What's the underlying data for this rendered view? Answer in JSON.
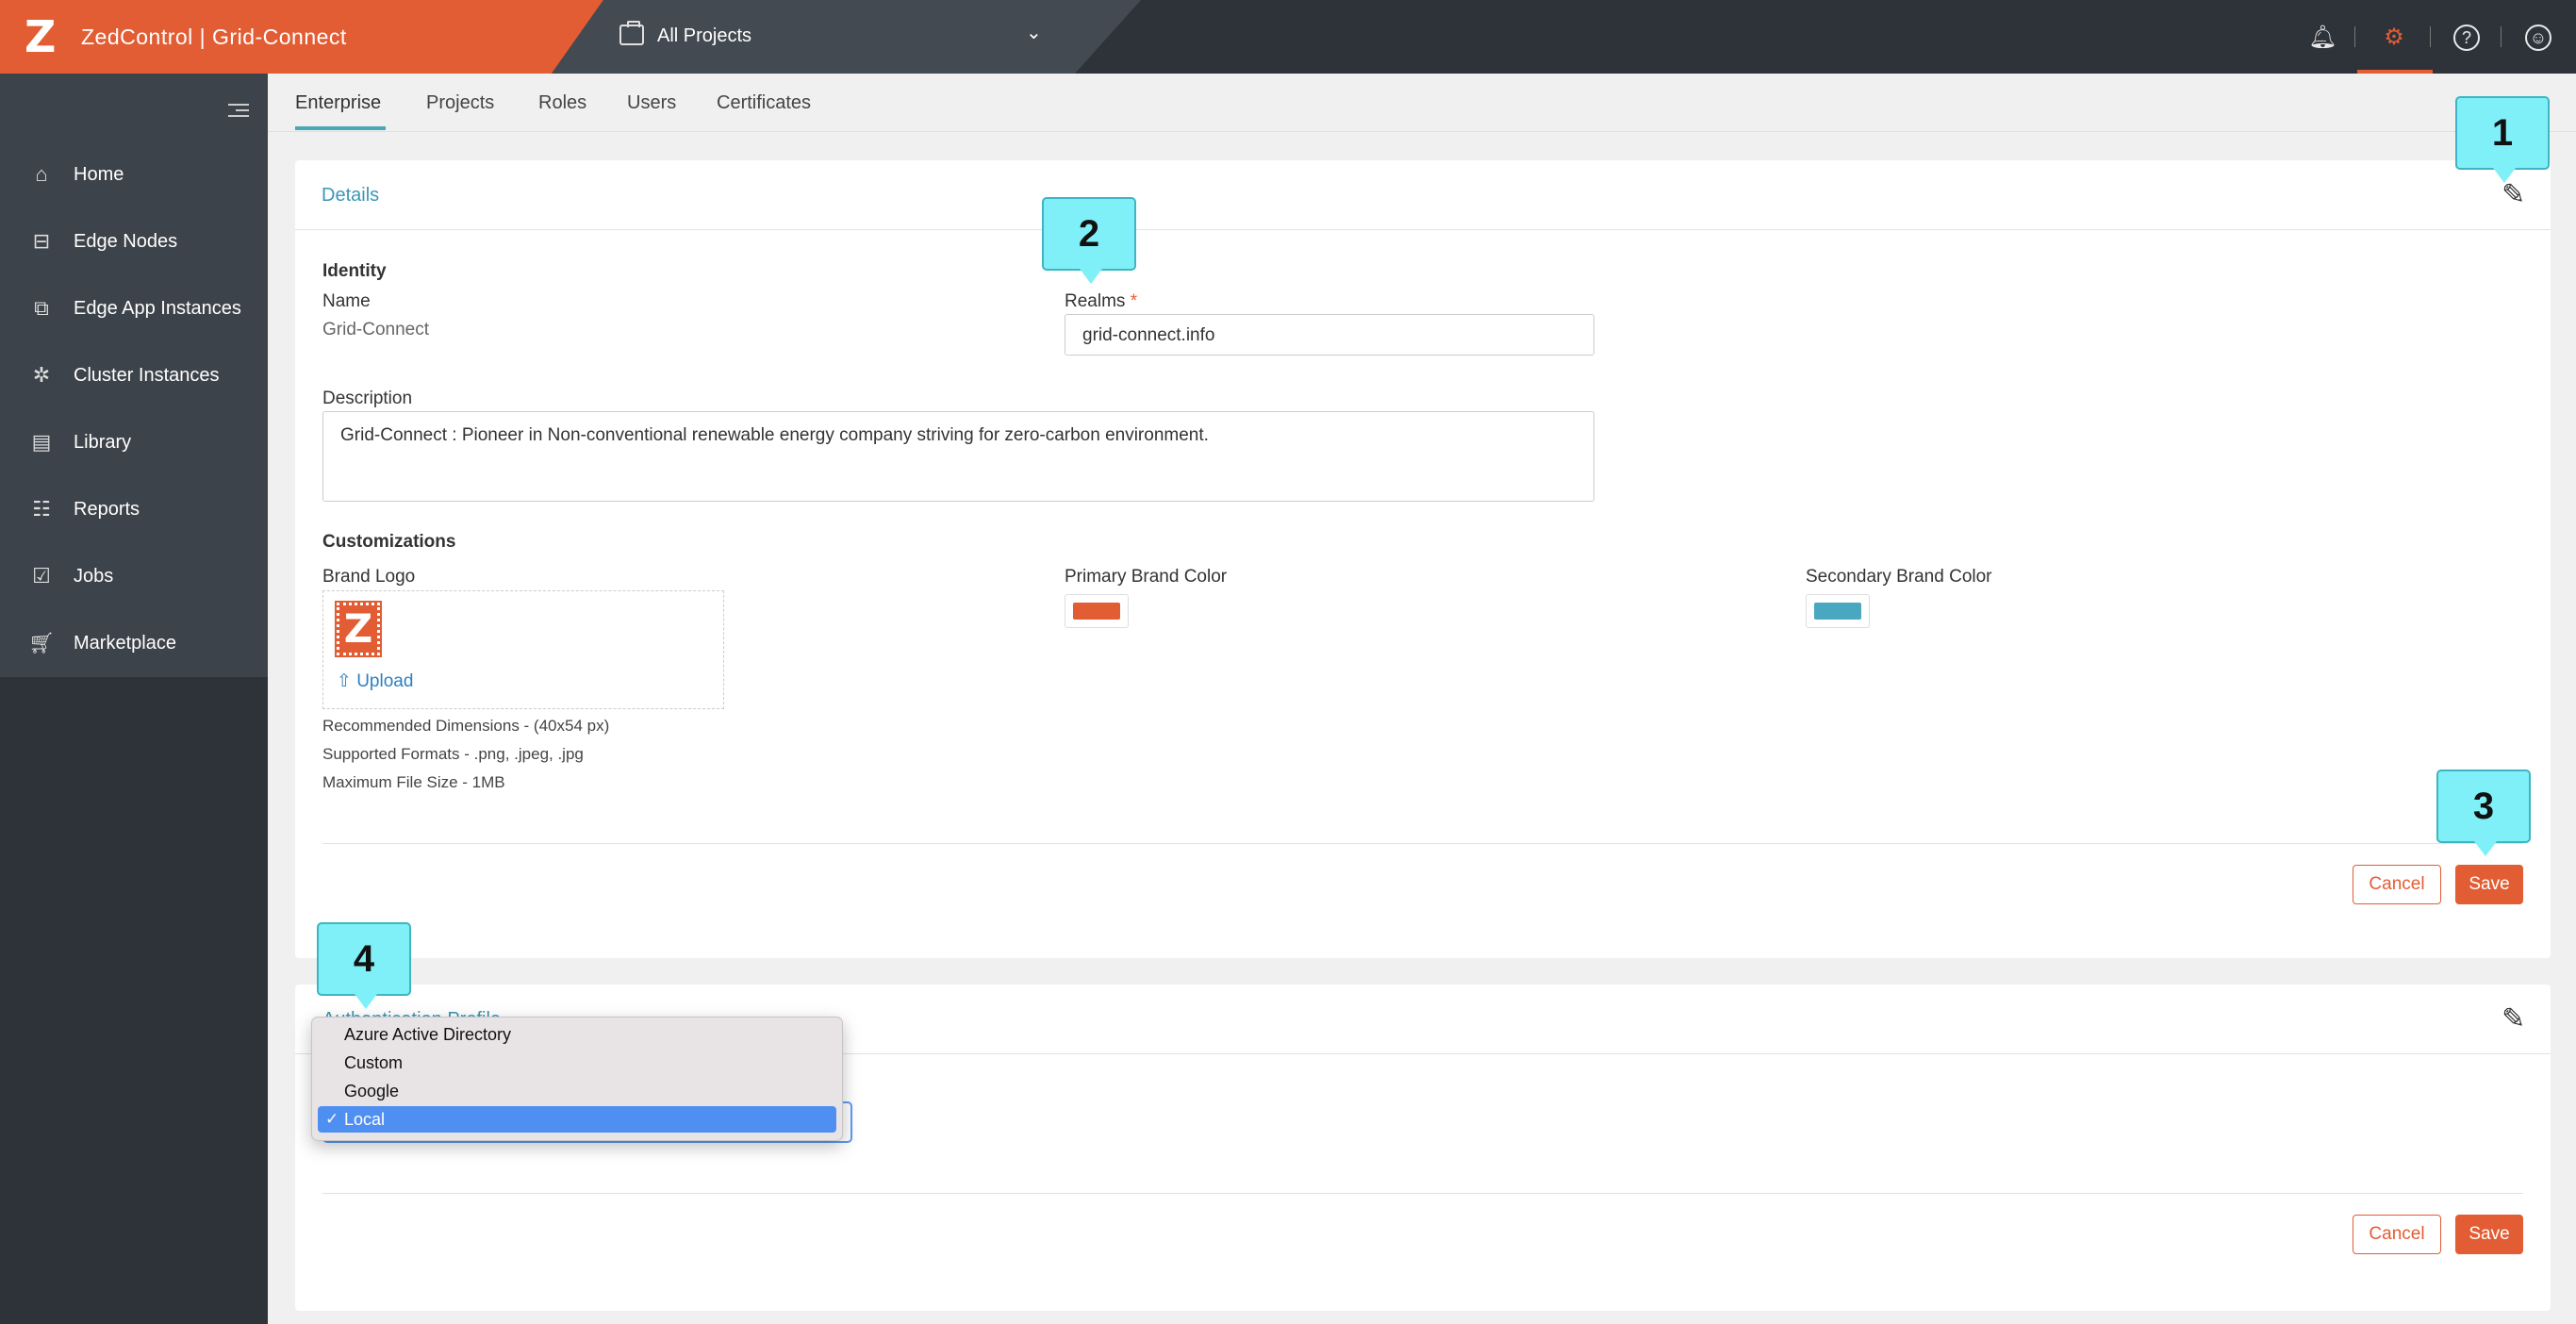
{
  "header": {
    "logo_letter": "Z",
    "app_title": "ZedControl | Grid-Connect",
    "project_selector": "All Projects"
  },
  "colors": {
    "accent": "#e25d33",
    "link": "#3c96b4",
    "primary_brand": "#e25d33",
    "secondary_brand": "#4aa7c0"
  },
  "sidebar": {
    "items": [
      {
        "label": "Home",
        "icon": "home-icon"
      },
      {
        "label": "Edge Nodes",
        "icon": "edge-node-icon"
      },
      {
        "label": "Edge App Instances",
        "icon": "app-instance-icon"
      },
      {
        "label": "Cluster Instances",
        "icon": "cluster-icon"
      },
      {
        "label": "Library",
        "icon": "library-icon"
      },
      {
        "label": "Reports",
        "icon": "reports-icon"
      },
      {
        "label": "Jobs",
        "icon": "jobs-icon"
      },
      {
        "label": "Marketplace",
        "icon": "cart-icon"
      }
    ]
  },
  "tabs": [
    "Enterprise",
    "Projects",
    "Roles",
    "Users",
    "Certificates"
  ],
  "details": {
    "title": "Details",
    "identity_heading": "Identity",
    "name_label": "Name",
    "name_value": "Grid-Connect",
    "realms_label": "Realms",
    "realms_required": "*",
    "realms_value": "grid-connect.info",
    "description_label": "Description",
    "description_value": "Grid-Connect : Pioneer in Non-conventional renewable energy company striving for zero-carbon environment.",
    "customizations_heading": "Customizations",
    "brand_logo_label": "Brand Logo",
    "upload_label": "Upload",
    "primary_color_label": "Primary Brand Color",
    "secondary_color_label": "Secondary Brand Color",
    "hint_dimensions": "Recommended Dimensions - (40x54 px)",
    "hint_formats": "Supported Formats - .png, .jpeg, .jpg",
    "hint_size": "Maximum File Size - 1MB",
    "cancel_label": "Cancel",
    "save_label": "Save"
  },
  "auth": {
    "title_partial": "Authentication Profile",
    "options": [
      "Azure Active Directory",
      "Custom",
      "Google",
      "Local"
    ],
    "selected": "Local",
    "check": "✓",
    "cancel_label": "Cancel",
    "save_label": "Save"
  },
  "callouts": [
    "1",
    "2",
    "3",
    "4"
  ]
}
